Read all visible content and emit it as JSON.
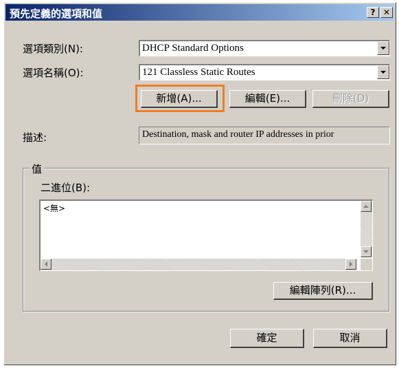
{
  "window": {
    "title": "預先定義的選項和值",
    "help_btn": "?",
    "close_btn": "✕"
  },
  "option_class": {
    "label": "選項類別(N):",
    "value": "DHCP Standard Options"
  },
  "option_name": {
    "label": "選項名稱(O):",
    "value": "121 Classless Static Routes"
  },
  "buttons": {
    "add": "新增(A)...",
    "edit": "編輯(E)...",
    "delete": "刪除(D)"
  },
  "description": {
    "label": "描述:",
    "value": "Destination, mask and router IP addresses in prior"
  },
  "value_group": {
    "title": "值",
    "binary_label": "二進位(B):",
    "binary_value": "<無>",
    "edit_array_button": "編輯陣列(R)..."
  },
  "footer": {
    "ok": "確定",
    "cancel": "取消"
  },
  "colors": {
    "highlight": "#f07c24",
    "titlebar": "#0a246a",
    "dialog_bg": "#d4d0c8"
  }
}
